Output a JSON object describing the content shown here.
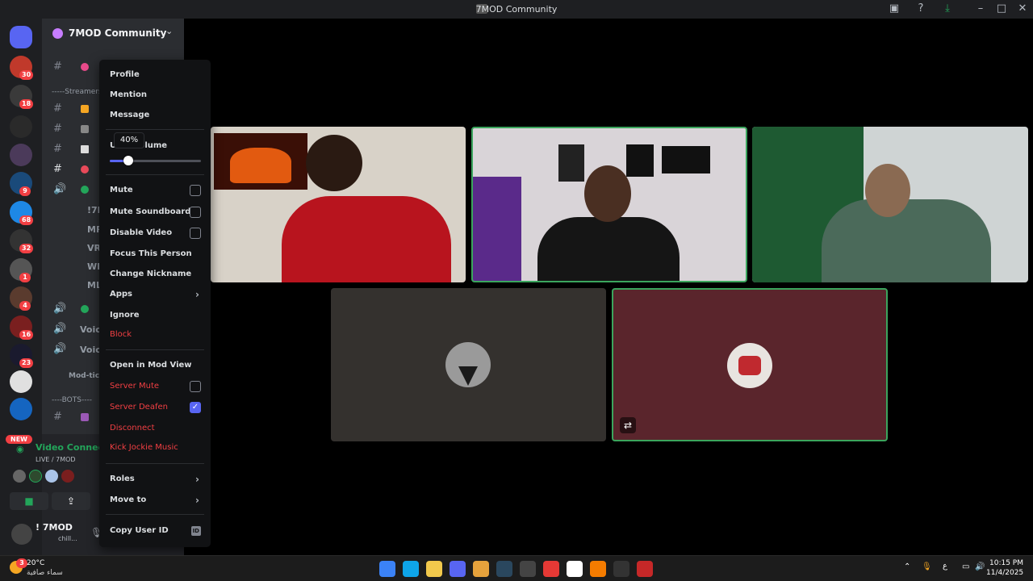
{
  "window": {
    "title": "7MOD Community",
    "icons": [
      "screen-share-icon",
      "help-icon",
      "download-icon",
      "minimize-icon",
      "maximize-icon",
      "close-icon"
    ]
  },
  "rail": {
    "badges": [
      {
        "name": "server-1",
        "count": "30",
        "color": "#c0392b"
      },
      {
        "name": "server-2",
        "count": "18",
        "color": "#3a3a3a"
      },
      {
        "name": "server-3",
        "count": "",
        "color": "#2a2a2a"
      },
      {
        "name": "server-4",
        "count": "",
        "color": "#4b3a5a"
      },
      {
        "name": "server-5",
        "count": "9",
        "color": "#1a4a7a"
      },
      {
        "name": "server-6",
        "count": "68",
        "color": "#1e88e5"
      },
      {
        "name": "server-7",
        "count": "32",
        "color": "#333333"
      },
      {
        "name": "server-8",
        "count": "1",
        "color": "#555555"
      },
      {
        "name": "server-9",
        "count": "4",
        "color": "#5a3b2e"
      },
      {
        "name": "server-10",
        "count": "16",
        "color": "#7a1f1f"
      },
      {
        "name": "server-11",
        "count": "23",
        "color": "#1a1a2e"
      },
      {
        "name": "server-12",
        "count": "",
        "color": "#e0e0e0"
      },
      {
        "name": "server-13",
        "count": "",
        "color": "#1565c0"
      }
    ],
    "new_label": "NEW"
  },
  "sidebar": {
    "guild_name": "7MOD Community",
    "categories": [
      "-----Streamers",
      "----BOTS----"
    ],
    "voice_channels": [
      "Voice",
      "Voice"
    ],
    "text_channel_partial": "Mod-tick",
    "partial_names": [
      "!7M",
      "MR",
      "VR",
      "WI",
      "ML"
    ]
  },
  "voice_panel": {
    "title": "Video Connected",
    "subtitle": "LIVE / 7MOD"
  },
  "user": {
    "name": "! 7MOD",
    "status": "chill..."
  },
  "context_menu": {
    "items": [
      {
        "label": "Profile",
        "style": "normal"
      },
      {
        "label": "Mention",
        "style": "normal"
      },
      {
        "label": "Message",
        "style": "normal"
      }
    ],
    "volume_label": "User Volume",
    "volume_percent": "40%",
    "volume_value": 0.2,
    "checks": [
      {
        "label": "Mute",
        "checked": false
      },
      {
        "label": "Mute Soundboard",
        "checked": false
      },
      {
        "label": "Disable Video",
        "checked": false
      }
    ],
    "actions": [
      {
        "label": "Focus This Person"
      },
      {
        "label": "Change Nickname"
      }
    ],
    "apps_label": "Apps",
    "ignore_label": "Ignore",
    "block_label": "Block",
    "mod_view_label": "Open in Mod View",
    "server_mute_label": "Server Mute",
    "server_deafen_label": "Server Deafen",
    "disconnect_label": "Disconnect",
    "kick_label": "Kick Jockie Music",
    "roles_label": "Roles",
    "move_label": "Move to",
    "copy_id_label": "Copy User ID",
    "id_badge": "ID"
  },
  "stage": {
    "tiles": [
      {
        "name": "video-tile-streamer-1",
        "bg": "#7a1e1e"
      },
      {
        "name": "video-tile-streamer-2",
        "bg": "#3a2f3f"
      },
      {
        "name": "video-tile-streamer-3",
        "bg": "#3a5a45"
      },
      {
        "name": "avatar-tile-cat",
        "bg": "#34312e"
      },
      {
        "name": "avatar-tile-bot",
        "bg": "#5a252c"
      }
    ]
  },
  "taskbar": {
    "weather_temp": "20°C",
    "weather_desc": "سماء صافية",
    "weather_badge": "3",
    "time": "10:15 PM",
    "date": "11/4/2025",
    "lang": "ع",
    "apps": [
      "windows-start-icon",
      "edge-icon",
      "file-explorer-icon",
      "discord-icon",
      "chat-app-icon",
      "steam-icon",
      "obs-icon",
      "opera-icon",
      "quickshare-icon",
      "app-a-icon",
      "epic-games-icon",
      "media-app-icon"
    ]
  }
}
